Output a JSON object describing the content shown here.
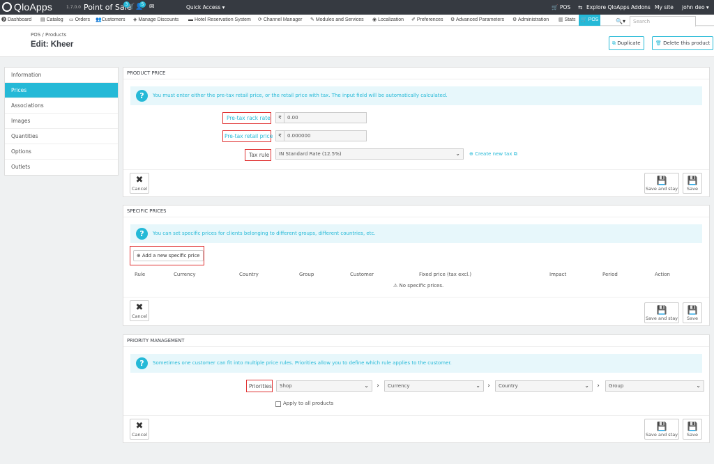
{
  "topbar": {
    "brand": "QloApps",
    "version": "1.7.0.0",
    "app_name": "Point of Sale",
    "cart_badge": "3",
    "user_badge": "5",
    "quick_access": "Quick Access ▾",
    "pos": "POS",
    "explore": "Explore QloApps Addons",
    "mysite": "My site",
    "user": "john deo ▾"
  },
  "menu": {
    "items": [
      "Dashboard",
      "Catalog",
      "Orders",
      "Customers",
      "Manage Discounts",
      "Hotel Reservation System",
      "Channel Manager",
      "Modules and Services",
      "Localization",
      "Preferences",
      "Advanced Parameters",
      "Administration",
      "Stats",
      "POS"
    ],
    "search_placeholder": "Search"
  },
  "header": {
    "breadcrumb_1": "POS",
    "breadcrumb_sep": "/",
    "breadcrumb_2": "Products",
    "title": "Edit: Kheer",
    "duplicate": "Duplicate",
    "delete": "Delete this product"
  },
  "sidebar": {
    "items": [
      "Information",
      "Prices",
      "Associations",
      "Images",
      "Quantities",
      "Options",
      "Outlets"
    ]
  },
  "product_price": {
    "heading": "PRODUCT PRICE",
    "info": "You must enter either the pre-tax retail price, or the retail price with tax. The input field will be automatically calculated.",
    "rack_label": "Pre-tax rack rate",
    "rack_currency": "₹",
    "rack_value": "0.00",
    "retail_label": "Pre-tax retail price",
    "retail_currency": "₹",
    "retail_value": "0.000000",
    "tax_label": "Tax rule",
    "tax_value": "IN Standard Rate (12.5%)",
    "create_tax": "Create new tax"
  },
  "specific_prices": {
    "heading": "SPECIFIC PRICES",
    "info": "You can set specific prices for clients belonging to different groups, different countries, etc.",
    "add_button": "Add a new specific price",
    "columns": [
      "Rule",
      "Currency",
      "Country",
      "Group",
      "Customer",
      "Fixed price (tax excl.)",
      "Impact",
      "Period",
      "Action"
    ],
    "empty": "No specific prices."
  },
  "priority": {
    "heading": "PRIORITY MANAGEMENT",
    "info": "Sometimes one customer can fit into multiple price rules. Priorities allow you to define which rule applies to the customer.",
    "label": "Priorities",
    "options": [
      "Shop",
      "Currency",
      "Country",
      "Group"
    ],
    "apply_all": "Apply to all products"
  },
  "footer_buttons": {
    "cancel": "Cancel",
    "save_stay": "Save and stay",
    "save": "Save"
  }
}
